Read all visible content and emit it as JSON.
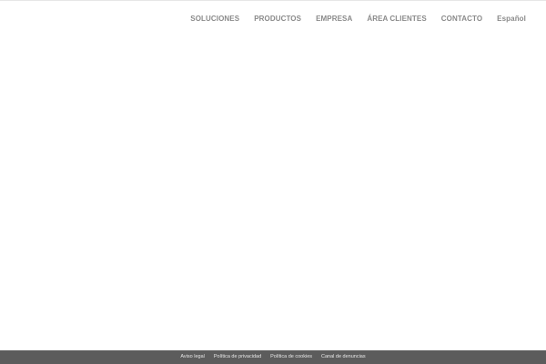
{
  "header": {
    "nav": [
      {
        "label": "SOLUCIONES"
      },
      {
        "label": "PRODUCTOS"
      },
      {
        "label": "EMPRESA"
      },
      {
        "label": "ÁREA CLIENTES"
      },
      {
        "label": "CONTACTO"
      }
    ],
    "language": "Español"
  },
  "footer": {
    "links": [
      {
        "label": "Aviso legal"
      },
      {
        "label": "Política de privacidad"
      },
      {
        "label": "Política de cookies"
      },
      {
        "label": "Canal de denuncias"
      }
    ]
  },
  "colors": {
    "nav_text": "#8a8a8a",
    "footer_bg": "#5c5c5c",
    "footer_text": "#e8e8e8",
    "page_bg": "#ffffff"
  }
}
